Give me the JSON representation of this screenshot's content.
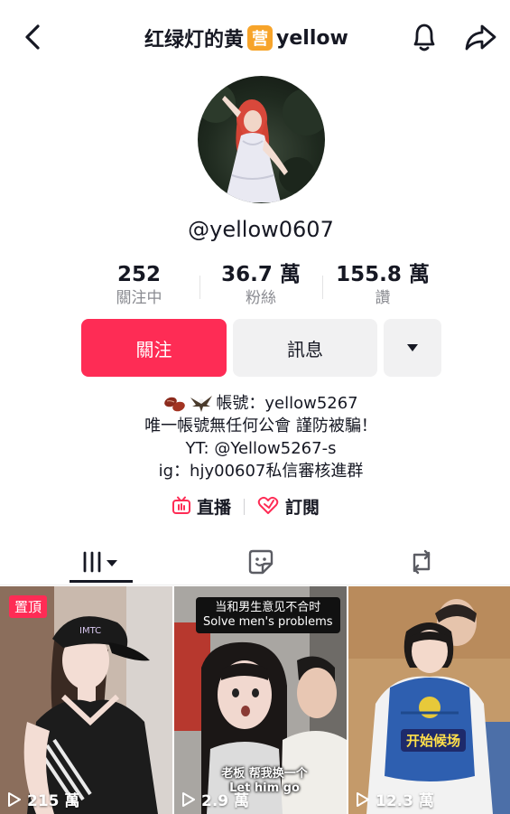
{
  "header": {
    "title": "红绿灯的黄",
    "badge": "营",
    "title_suffix": "yellow"
  },
  "profile": {
    "username": "@yellow0607"
  },
  "stats": [
    {
      "value": "252",
      "label": "關注中"
    },
    {
      "value": "36.7 萬",
      "label": "粉絲"
    },
    {
      "value": "155.8 萬",
      "label": "讚"
    }
  ],
  "actions": {
    "follow_label": "關注",
    "message_label": "訊息"
  },
  "bio": {
    "line1": "帳號：yellow5267",
    "line2": "唯一帳號無任何公會 謹防被騙！",
    "line3": "YT: @Yellow5267-s",
    "line4": "ig：hjy00607私信審核進群"
  },
  "links": {
    "live_label": "直播",
    "subscribe_label": "訂閱"
  },
  "videos": [
    {
      "pinned_label": "置頂",
      "views": "215 萬"
    },
    {
      "caption_top1": "当和男生意见不合时",
      "caption_top2": "Solve men's problems",
      "sub1": "老板 帮我换一个",
      "sub2": "Let him go",
      "views": "2.9 萬"
    },
    {
      "caption": "开始候场",
      "views": "12.3 萬"
    }
  ],
  "colors": {
    "accent": "#fe2c55",
    "badge": "#f7a42a",
    "text": "#161823",
    "muted": "#8a8b91"
  },
  "icons": [
    "back-arrow-icon",
    "bell-icon",
    "share-icon",
    "caret-down-icon",
    "live-tv-icon",
    "subscribe-icon",
    "grid-icon",
    "favorites-icon",
    "repost-icon",
    "play-icon"
  ]
}
